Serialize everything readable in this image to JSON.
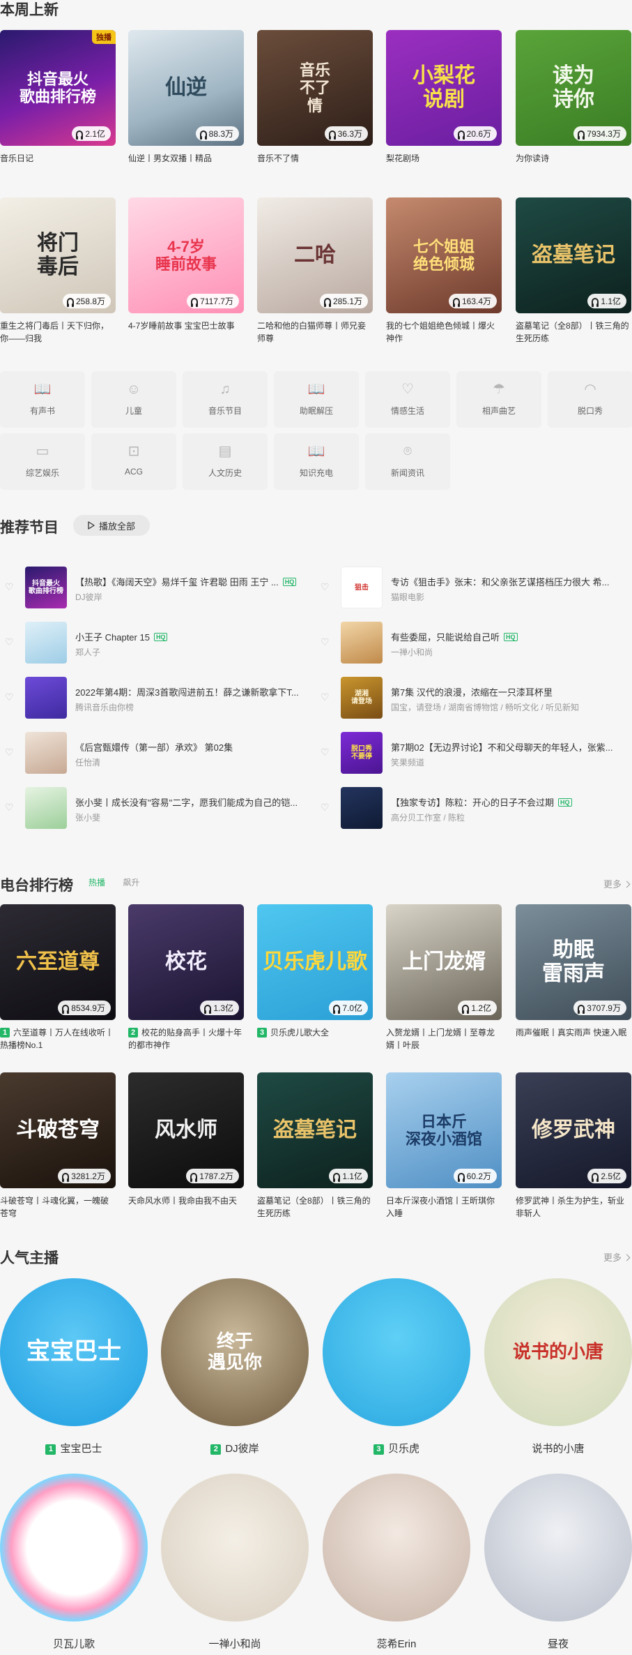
{
  "weekly": {
    "title": "本周上新",
    "items": [
      {
        "title": "音乐日记",
        "plays": "2.1亿",
        "art": "抖音最火\n歌曲排行榜",
        "tag": "独播",
        "bg": "linear-gradient(160deg,#2a1a6e,#7a1fa8 55%,#d8398e)",
        "fg": "#ffffff"
      },
      {
        "title": "仙逆丨男女双播丨精品",
        "plays": "88.3万",
        "art": "仙逆",
        "bg": "linear-gradient(160deg,#dfe8ee,#9fb5c3 60%,#5e7383)",
        "fg": "#2e4a5c"
      },
      {
        "title": "音乐不了情",
        "plays": "36.3万",
        "art": "音乐\n不了\n情",
        "bg": "linear-gradient(160deg,#6b4d3b,#2d1e18)",
        "fg": "#f3e6d4"
      },
      {
        "title": "梨花剧场",
        "plays": "20.6万",
        "art": "小梨花\n说剧",
        "bg": "linear-gradient(160deg,#9b2fc0,#6a1ea0)",
        "fg": "#f7e24a"
      },
      {
        "title": "为你读诗",
        "plays": "7934.3万",
        "art": "读为\n诗你",
        "bg": "linear-gradient(160deg,#5aa43a,#3a7d24)",
        "fg": "#f2f8ea"
      },
      {
        "title": "重生之将门毒后丨天下归你，你——归我",
        "plays": "258.8万",
        "art": "将门\n毒后",
        "bg": "linear-gradient(160deg,#f3efe6,#cfc6b8)",
        "fg": "#2a2a2a"
      },
      {
        "title": "4-7岁睡前故事 宝宝巴士故事",
        "plays": "7117.7万",
        "art": "4-7岁\n睡前故事",
        "bg": "linear-gradient(160deg,#ffd9e6,#ff8fb5)",
        "fg": "#e8344d"
      },
      {
        "title": "二哈和他的白猫师尊丨师兄妾师尊",
        "plays": "285.1万",
        "art": "二哈",
        "bg": "linear-gradient(160deg,#f1ece6,#b9a9a0)",
        "fg": "#6a3434"
      },
      {
        "title": "我的七个姐姐绝色倾城丨爆火神作",
        "plays": "163.4万",
        "art": "七个姐姐\n绝色倾城",
        "bg": "linear-gradient(160deg,#c58a6e,#6e3a2c)",
        "fg": "#ffe07a"
      },
      {
        "title": "盗墓笔记（全8部）丨铁三角的生死历练",
        "plays": "1.1亿",
        "art": "盗墓笔记",
        "bg": "linear-gradient(160deg,#1f4a44,#0d211e)",
        "fg": "#e9c36a"
      }
    ]
  },
  "categories": [
    {
      "label": "有声书",
      "icon": "book-icon",
      "glyph": "📖"
    },
    {
      "label": "儿童",
      "icon": "child-icon",
      "glyph": "☺"
    },
    {
      "label": "音乐节目",
      "icon": "music-note-icon",
      "glyph": "♫"
    },
    {
      "label": "助眠解压",
      "icon": "sleep-book-icon",
      "glyph": "📖"
    },
    {
      "label": "情感生活",
      "icon": "heart-icon",
      "glyph": "♡"
    },
    {
      "label": "相声曲艺",
      "icon": "umbrella-icon",
      "glyph": "☂"
    },
    {
      "label": "脱口秀",
      "icon": "lips-icon",
      "glyph": "◠"
    },
    {
      "label": "综艺娱乐",
      "icon": "tv-icon",
      "glyph": "▭"
    },
    {
      "label": "ACG",
      "icon": "gamepad-icon",
      "glyph": "⊡"
    },
    {
      "label": "人文历史",
      "icon": "history-book-icon",
      "glyph": "▤"
    },
    {
      "label": "知识充电",
      "icon": "knowledge-book-icon",
      "glyph": "📖"
    },
    {
      "label": "新闻资讯",
      "icon": "news-icon",
      "glyph": "⌾"
    }
  ],
  "recommend": {
    "title": "推荐节目",
    "play_all": "播放全部",
    "items": [
      {
        "title": "【热歌】《海阔天空》易烊千玺 许君聪 田雨 王宁 ...",
        "sub": "DJ彼岸",
        "hq": true,
        "thumb": "抖音最火\n歌曲排行榜",
        "bg": "linear-gradient(160deg,#2a1a6e,#a92cb0)",
        "fg": "#fff"
      },
      {
        "title": "专访《狙击手》张末：和父亲张艺谋搭档压力很大 希...",
        "sub": "猫眼电影",
        "hq": false,
        "thumb": "狙击",
        "bg": "#ffffff",
        "fg": "#d0302c"
      },
      {
        "title": "小王子 Chapter 15",
        "sub": "郑人子",
        "hq": true,
        "thumb": "",
        "bg": "linear-gradient(160deg,#dff0f8,#9ecde6)",
        "fg": "#3a7ea5"
      },
      {
        "title": "有些委屈，只能说给自己听",
        "sub": "一禅小和尚",
        "hq": true,
        "thumb": "",
        "bg": "linear-gradient(160deg,#f2d6a8,#c08a4a)",
        "fg": "#5a3515"
      },
      {
        "title": "2022年第4期：周深3首歌闯进前五！薛之谦新歌拿下T...",
        "sub": "腾讯音乐由你榜",
        "hq": false,
        "thumb": "",
        "bg": "linear-gradient(160deg,#6d4bd8,#3f2aa0)",
        "fg": "#fff"
      },
      {
        "title": "第7集 汉代的浪漫，浓缩在一只漆耳杯里",
        "sub": "国宝，请登场 / 湖南省博物馆 / 畅听文化 / 听见新知",
        "hq": false,
        "thumb": "湖湘\n请登场",
        "bg": "linear-gradient(160deg,#c9962e,#7a4d14)",
        "fg": "#fff6d8"
      },
      {
        "title": "《后宫甄嬛传（第一部）承欢》 第02集",
        "sub": "任怡清",
        "hq": false,
        "thumb": "",
        "bg": "linear-gradient(160deg,#efe3d8,#c7a994)",
        "fg": "#6a3a2a"
      },
      {
        "title": "第7期02【无边界讨论】不和父母聊天的年轻人，张紫...",
        "sub": "笑果频道",
        "hq": false,
        "thumb": "脱口秀\n不要停",
        "bg": "linear-gradient(160deg,#7d2ad6,#4b1592)",
        "fg": "#ffe34a"
      },
      {
        "title": "张小斐丨成长没有\"容易\"二字，愿我们能成为自己的铠...",
        "sub": "张小斐",
        "hq": false,
        "thumb": "",
        "bg": "linear-gradient(160deg,#e6f3e2,#9ccf9a)",
        "fg": "#2f6a2f"
      },
      {
        "title": "【独家专访】陈粒：开心的日子不会过期",
        "sub": "高分贝工作室 / 陈粒",
        "hq": true,
        "thumb": "",
        "bg": "linear-gradient(160deg,#23345e,#0f1a33)",
        "fg": "#f2c64a"
      }
    ]
  },
  "radio": {
    "title": "电台排行榜",
    "tab_hot": "热播",
    "tab_rise": "飙升",
    "more": "更多",
    "items": [
      {
        "rank": "1",
        "title": "六至道尊丨万人在线收听丨热播榜No.1",
        "plays": "8534.9万",
        "art": "六至道尊",
        "bg": "linear-gradient(160deg,#2d2a33,#0e0d12)",
        "fg": "#f0c14a"
      },
      {
        "rank": "2",
        "title": "校花的贴身高手丨火爆十年的都市神作",
        "plays": "1.3亿",
        "art": "校花",
        "bg": "linear-gradient(160deg,#4a3a6a,#1a1430)",
        "fg": "#f5f0ff"
      },
      {
        "rank": "3",
        "title": "贝乐虎儿歌大全",
        "plays": "7.0亿",
        "art": "贝乐虎儿歌",
        "bg": "linear-gradient(160deg,#4fc7f0,#2a9fd6)",
        "fg": "#ffd83a"
      },
      {
        "rank": "",
        "title": "入赘龙婿丨上门龙婿丨至尊龙婿丨叶辰",
        "plays": "1.2亿",
        "art": "上门龙婿",
        "bg": "linear-gradient(160deg,#d9d4c8,#6a6458)",
        "fg": "#ffffff"
      },
      {
        "rank": "",
        "title": "雨声催眠丨真实雨声 快速入眠",
        "plays": "3707.9万",
        "art": "助眠\n雷雨声",
        "bg": "linear-gradient(160deg,#7b8e9a,#3e4c57)",
        "fg": "#ffffff"
      },
      {
        "rank": "",
        "title": "斗破苍穹丨斗魂化翼，一魄破苍穹",
        "plays": "3281.2万",
        "art": "斗破苍穹",
        "bg": "linear-gradient(160deg,#4a3a2e,#1a120c)",
        "fg": "#ffffff"
      },
      {
        "rank": "",
        "title": "天命风水师丨我命由我不由天",
        "plays": "1787.2万",
        "art": "风水师",
        "bg": "linear-gradient(160deg,#2c2c2c,#0c0c0c)",
        "fg": "#f2f2f2"
      },
      {
        "rank": "",
        "title": "盗墓笔记（全8部）丨铁三角的生死历练",
        "plays": "1.1亿",
        "art": "盗墓笔记",
        "bg": "linear-gradient(160deg,#1f4a44,#0d211e)",
        "fg": "#e9c36a"
      },
      {
        "rank": "",
        "title": "日本斤深夜小酒馆丨王昕琪你入睡",
        "plays": "60.2万",
        "art": "日本斤\n深夜小酒馆",
        "bg": "linear-gradient(160deg,#a8d0ee,#4f8fc4)",
        "fg": "#1c3c66"
      },
      {
        "rank": "",
        "title": "修罗武神丨杀生为护生，斩业非斩人",
        "plays": "2.5亿",
        "art": "修罗武神",
        "bg": "linear-gradient(160deg,#3a3f55,#15182a)",
        "fg": "#f5e6c8"
      }
    ]
  },
  "hosts": {
    "title": "人气主播",
    "more": "更多",
    "items": [
      {
        "rank": "1",
        "name": "宝宝巴士",
        "art": "宝宝巴士",
        "bg": "radial-gradient(circle at 50% 40%,#5cc8f5,#1e9de0)",
        "fg": "#ffffff"
      },
      {
        "rank": "2",
        "name": "DJ彼岸",
        "art": "终于\n遇见你",
        "bg": "radial-gradient(circle at 50% 40%,#c9b89a,#6e5a3e)",
        "fg": "#ffffff"
      },
      {
        "rank": "3",
        "name": "贝乐虎",
        "art": "",
        "bg": "radial-gradient(circle at 50% 40%,#5fd0f6,#2aa7e0)",
        "fg": "#ffffff"
      },
      {
        "rank": "",
        "name": "说书的小唐",
        "art": "说书的小唐",
        "bg": "radial-gradient(circle at 50% 40%,#f4ecd8,#cdd9b8)",
        "fg": "#c8312a"
      },
      {
        "rank": "",
        "name": "贝瓦儿歌",
        "art": "",
        "bg": "radial-gradient(circle at 50% 50%,#ffffff 45%,#ff9ec4 60%,#7fd6ff 70%,#ffe45a 80%)",
        "fg": "#ffffff"
      },
      {
        "rank": "",
        "name": "一禅小和尚",
        "art": "",
        "bg": "radial-gradient(circle at 50% 45%,#f4efe6,#d9cfc0)",
        "fg": "#3a2a1a"
      },
      {
        "rank": "",
        "name": "蕊希Erin",
        "art": "",
        "bg": "radial-gradient(circle at 50% 40%,#f3e9e2,#c7b3a6)",
        "fg": "#3a2a1a"
      },
      {
        "rank": "",
        "name": "昼夜",
        "art": "",
        "bg": "radial-gradient(circle at 50% 40%,#eef0f4,#b7bdc9)",
        "fg": "#1a1d2a"
      }
    ]
  },
  "colors": {
    "accent": "#22b667",
    "bg": "#f6f6f6",
    "muted": "#999999"
  }
}
